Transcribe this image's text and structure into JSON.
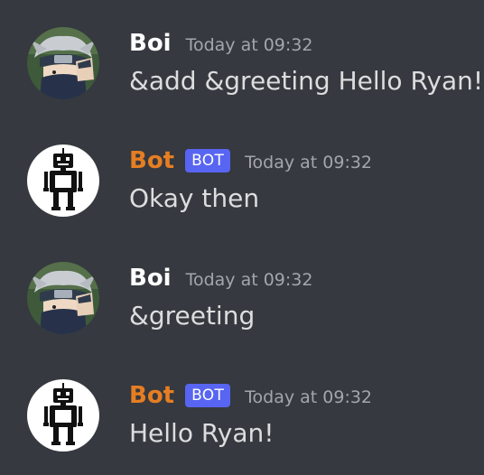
{
  "messages": [
    {
      "author": "Boi",
      "is_bot": false,
      "avatar": "kakashi-avatar",
      "timestamp": "Today at 09:32",
      "content": "&add &greeting Hello Ryan!"
    },
    {
      "author": "Bot",
      "is_bot": true,
      "bot_tag": "BOT",
      "avatar": "robot-avatar",
      "timestamp": "Today at 09:32",
      "content": "Okay then"
    },
    {
      "author": "Boi",
      "is_bot": false,
      "avatar": "kakashi-avatar",
      "timestamp": "Today at 09:32",
      "content": "&greeting"
    },
    {
      "author": "Bot",
      "is_bot": true,
      "bot_tag": "BOT",
      "avatar": "robot-avatar",
      "timestamp": "Today at 09:32",
      "content": "Hello Ryan!"
    }
  ],
  "colors": {
    "background": "#36393f",
    "user_name": "#ffffff",
    "bot_name": "#e67e22",
    "bot_tag": "#5865f2",
    "timestamp": "#a3a6aa",
    "message_text": "#dcddde"
  }
}
